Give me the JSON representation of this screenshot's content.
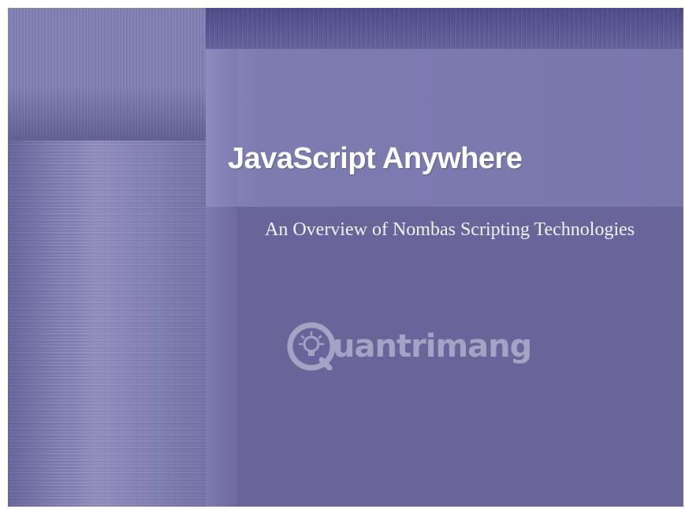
{
  "slide": {
    "title": "JavaScript Anywhere",
    "subtitle": "An Overview of Nombas Scripting Technologies"
  },
  "watermark": {
    "text": "uantrimang",
    "icon": "lightbulb-q-logo-icon"
  },
  "colors": {
    "background": "#67659a",
    "title_panel": "#7978ad",
    "title_text": "#ffffff",
    "subtitle_text": "#f2f2fa"
  }
}
